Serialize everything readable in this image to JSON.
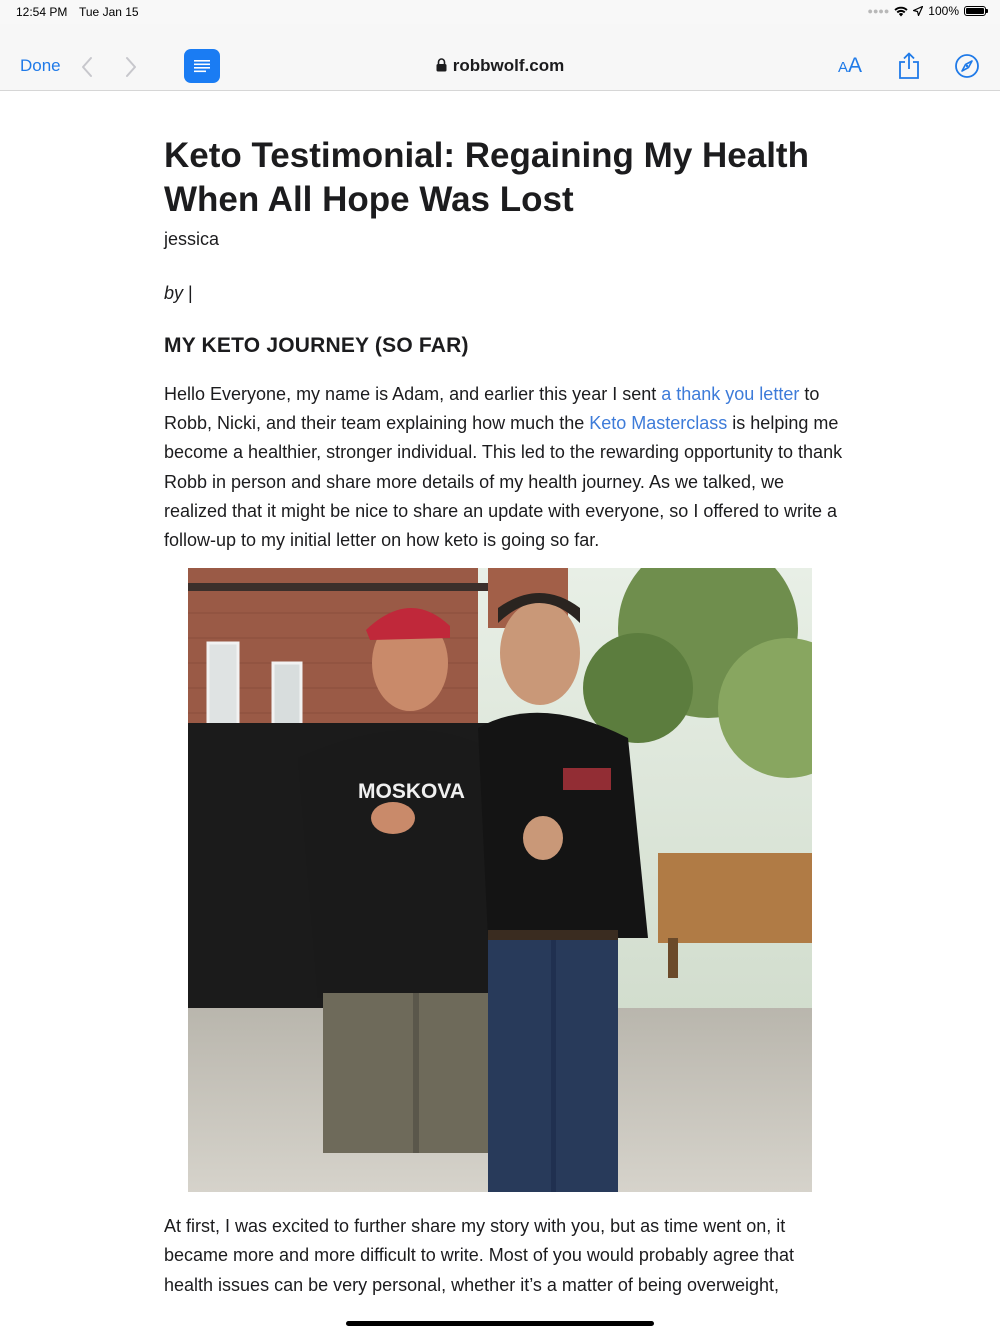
{
  "status": {
    "time": "12:54 PM",
    "date": "Tue Jan 15",
    "battery": "100%"
  },
  "toolbar": {
    "done_label": "Done",
    "domain": "robbwolf.com",
    "text_size_small": "A",
    "text_size_big": "A"
  },
  "article": {
    "title": "Keto Testimonial: Regaining My Health When All Hope Was Lost",
    "author": "jessica",
    "byline_prefix": "by",
    "byline_sep": "|",
    "section_heading": "MY KETO JOURNEY (SO FAR)",
    "para1": {
      "t1": "Hello Everyone, my name is Adam, and earlier this year I sent ",
      "link1": "a thank you letter",
      "t2": " to Robb, Nicki, and their team explaining how much the ",
      "link2": "Keto Masterclass",
      "t3": " is helping me become a healthier, stronger individual. This led to the rewarding opportunity to thank Robb in person and share more details of my health journey. As we talked, we realized that it might be nice to share an update with everyone, so I offered to write a follow-up to my initial letter on how keto is going so far."
    },
    "photo": {
      "shirt_text": "MOSKOVA"
    },
    "para2": "At first, I was excited to further share my story with you, but as time went on, it became more and more difficult to write. Most of you would probably agree that health issues can be very personal, whether it’s a matter of being overweight,"
  },
  "colors": {
    "accent": "#1f7ae8",
    "link": "#3d7bd9",
    "reader_button": "#1a7cf3"
  },
  "icons": [
    "back-chevron-icon",
    "forward-chevron-icon",
    "reader-view-icon",
    "lock-icon",
    "share-icon",
    "compass-icon",
    "wifi-icon",
    "location-icon",
    "battery-icon"
  ]
}
